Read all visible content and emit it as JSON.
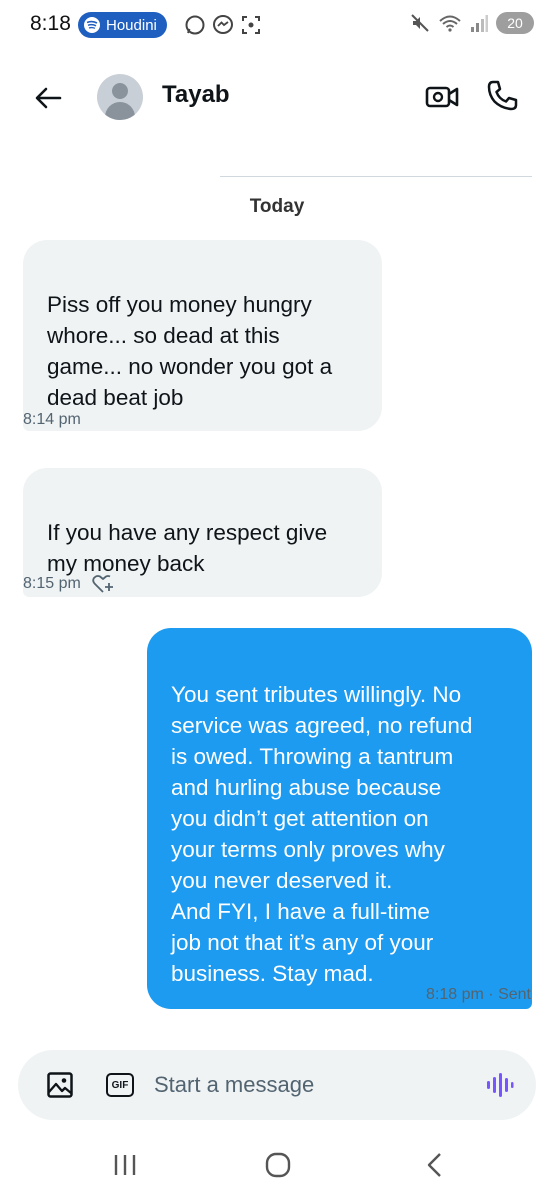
{
  "status_bar": {
    "time": "8:18",
    "music_app": "Houdini",
    "battery": "20"
  },
  "header": {
    "contact_name": "Tayab"
  },
  "conversation": {
    "date_label": "Today",
    "messages": [
      {
        "direction": "incoming",
        "text": "Piss off you money hungry\nwhore... so dead at this\ngame... no wonder you got a\ndead beat job",
        "time": "8:14 pm"
      },
      {
        "direction": "incoming",
        "text": "If you have any respect give\nmy money back",
        "time": "8:15 pm"
      },
      {
        "direction": "outgoing",
        "text": "You sent tributes willingly. No\nservice was agreed, no refund\nis owed. Throwing a tantrum\nand hurling abuse because\nyou didn’t get attention on\nyour terms only proves why\nyou never deserved it.\nAnd FYI, I have a full-time\njob  not that it’s any of your\nbusiness. Stay mad.",
        "time": "8:18 pm · Sent"
      }
    ]
  },
  "composer": {
    "gif_label": "GIF",
    "placeholder": "Start a message"
  },
  "colors": {
    "accent": "#1d9bf0",
    "incoming_bubble": "#eff3f4",
    "voice_icon": "#7856ff"
  },
  "icons": {
    "back": "arrow-left-icon",
    "video": "video-camera-icon",
    "call": "phone-icon",
    "media": "image-icon",
    "voice": "voice-waveform-icon",
    "react": "heart-plus-icon"
  }
}
